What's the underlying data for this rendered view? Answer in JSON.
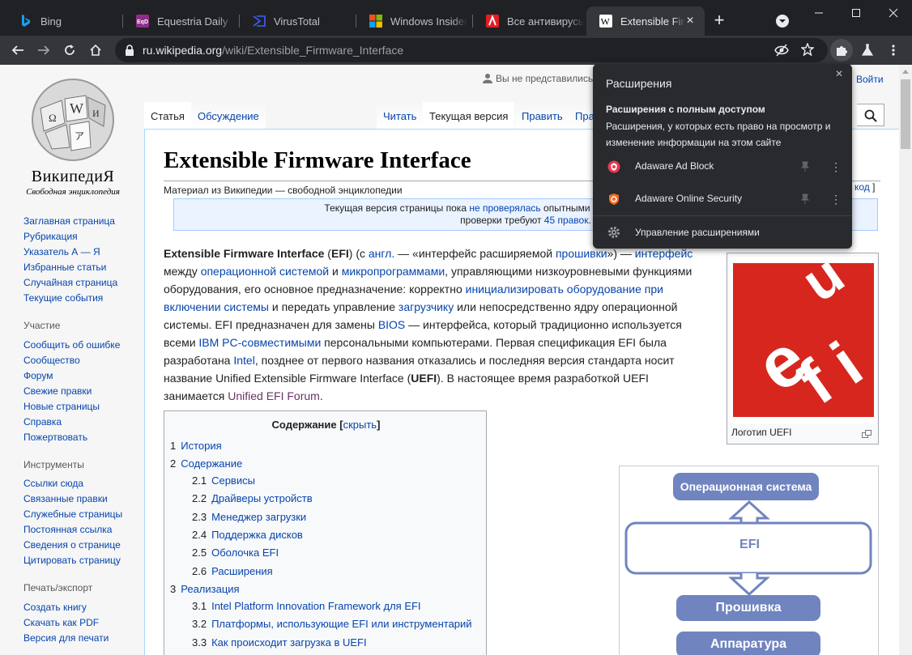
{
  "tabs": [
    {
      "label": "Bing",
      "icon": "bing-icon",
      "active": false
    },
    {
      "label": "Equestria Daily",
      "icon": "equestria-daily-icon",
      "active": false
    },
    {
      "label": "VirusTotal",
      "icon": "virustotal-icon",
      "active": false
    },
    {
      "label": "Windows Insider",
      "icon": "microsoft-icon",
      "active": false
    },
    {
      "label": "Все антивирусы",
      "icon": "antivirus-site-icon",
      "active": false
    },
    {
      "label": "Extensible Firmware",
      "icon": "wikipedia-icon",
      "active": true
    }
  ],
  "address_bar": {
    "domain": "ru.wikipedia.org",
    "path": "/wiki/Extensible_Firmware_Interface"
  },
  "wiki": {
    "logo_name": "ВикипедиЯ",
    "logo_sub": "Свободная энциклопедия",
    "nav_main": [
      "Заглавная страница",
      "Рубрикация",
      "Указатель А — Я",
      "Избранные статьи",
      "Случайная страница",
      "Текущие события"
    ],
    "nav_participation_title": "Участие",
    "nav_participation": [
      "Сообщить об ошибке",
      "Сообщество",
      "Форум",
      "Свежие правки",
      "Новые страницы",
      "Справка",
      "Пожертвовать"
    ],
    "nav_tools_title": "Инструменты",
    "nav_tools": [
      "Ссылки сюда",
      "Связанные правки",
      "Служебные страницы",
      "Постоянная ссылка",
      "Сведения о странице",
      "Цитировать страницу"
    ],
    "nav_print_title": "Печать/экспорт",
    "nav_print": [
      "Создать книгу",
      "Скачать как PDF",
      "Версия для печати"
    ],
    "personal": "Вы не представились",
    "login": "Войти",
    "tab_article": "Статья",
    "tab_talk": "Обсуждение",
    "tab_read": "Читать",
    "tab_current": "Текущая версия",
    "tab_edit": "Править",
    "tab_more": "Пра",
    "title": "Extensible Firmware Interface",
    "site_sub": "Материал из Википедии — свободной энциклопедии",
    "edit_code": "код",
    "notice_1": "Текущая версия страницы пока ",
    "notice_link1": "не проверялась",
    "notice_2": " опытными участниками и может значите",
    "notice_3": "проверки требуют ",
    "notice_link2": "45 правок",
    "infobox_caption": "Логотип UEFI",
    "toc_title": "Содержание",
    "toc_hide": "скрыть",
    "toc": [
      {
        "num": "1",
        "label": "История",
        "level": 1
      },
      {
        "num": "2",
        "label": "Содержание",
        "level": 1
      },
      {
        "num": "2.1",
        "label": "Сервисы",
        "level": 2
      },
      {
        "num": "2.2",
        "label": "Драйверы устройств",
        "level": 2
      },
      {
        "num": "2.3",
        "label": "Менеджер загрузки",
        "level": 2
      },
      {
        "num": "2.4",
        "label": "Поддержка дисков",
        "level": 2
      },
      {
        "num": "2.5",
        "label": "Оболочка EFI",
        "level": 2
      },
      {
        "num": "2.6",
        "label": "Расширения",
        "level": 2
      },
      {
        "num": "3",
        "label": "Реализация",
        "level": 1
      },
      {
        "num": "3.1",
        "label": "Intel Platform Innovation Framework для EFI",
        "level": 2
      },
      {
        "num": "3.2",
        "label": "Платформы, использующие EFI или инструментарий",
        "level": 2
      },
      {
        "num": "3.3",
        "label": "Как происходит загрузка в UEFI",
        "level": 2
      }
    ],
    "diagram": {
      "os": "Операционная система",
      "efi": "EFI",
      "firmware": "Прошивка",
      "hardware": "Аппаратура"
    }
  },
  "extensions_popup": {
    "title": "Расширения",
    "subtitle": "Расширения с полным доступом",
    "description": "Расширения, у которых есть право на просмотр и изменение информации на этом сайте",
    "items": [
      {
        "name": "Adaware Ad Block",
        "icon": "adaware-ad-block-icon"
      },
      {
        "name": "Adaware Online Security",
        "icon": "adaware-online-security-icon"
      }
    ],
    "manage": "Управление расширениями"
  },
  "colors": {
    "chrome_dark": "#202124",
    "toolbar": "#35363a",
    "link": "#0645ad",
    "uefi_red": "#d7261e",
    "diagram_blue": "#7084bf"
  }
}
